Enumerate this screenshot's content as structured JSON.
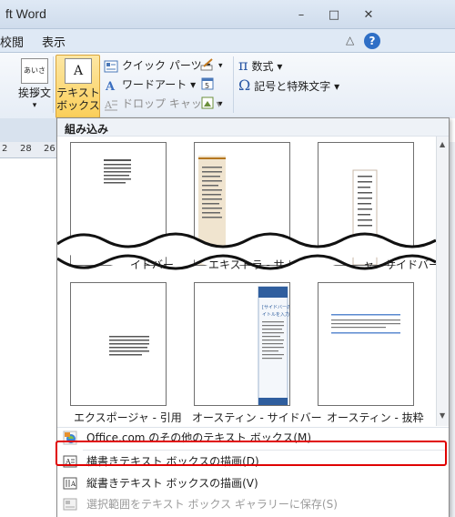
{
  "window": {
    "title": "ft Word",
    "min_glyph": "–",
    "max_glyph": "□",
    "close_glyph": "✕"
  },
  "tabs": {
    "review": "校閲",
    "view": "表示",
    "collapse_glyph": "△",
    "help_glyph": "?"
  },
  "ribbon": {
    "greeting_icon_text": "あいさつ",
    "greeting_label": "挨拶文",
    "textbox_label_line1": "テキスト",
    "textbox_label_line2": "ボックス",
    "textbox_icon_text": "A",
    "quick_parts": "クイック パーツ",
    "wordart": "ワードアート",
    "drop_cap": "ドロップ キャップ",
    "equation": "数式",
    "symbols": "記号と特殊文字",
    "pi_glyph": "π",
    "omega_glyph": "Ω",
    "dropdown_glyph": "▾"
  },
  "ruler": {
    "ticks": [
      "2",
      "28",
      "26"
    ]
  },
  "panel": {
    "header": "組み込み",
    "thumbs": [
      {
        "label": "イドバー"
      },
      {
        "label": "エキストラ - サ"
      },
      {
        "label": "ャ - サイドバー"
      },
      {
        "label": "エクスポージャ - 引用"
      },
      {
        "label": "オースティン - サイドバー"
      },
      {
        "label": "オースティン - 抜粋"
      }
    ],
    "austin_sidebar_text": "[サイドバーのタイトルを入力]"
  },
  "menu": {
    "items": [
      {
        "label": "Office.com のその他のテキスト ボックス(M)",
        "disabled": false
      },
      {
        "label": "横書きテキスト ボックスの描画(D)",
        "disabled": false
      },
      {
        "label": "縦書きテキスト ボックスの描画(V)",
        "disabled": false
      },
      {
        "label": "選択範囲をテキスト ボックス ギャラリーに保存(S)",
        "disabled": true
      }
    ]
  },
  "colors": {
    "highlight": "#e00000",
    "accent_blue": "#2f6fc6"
  }
}
